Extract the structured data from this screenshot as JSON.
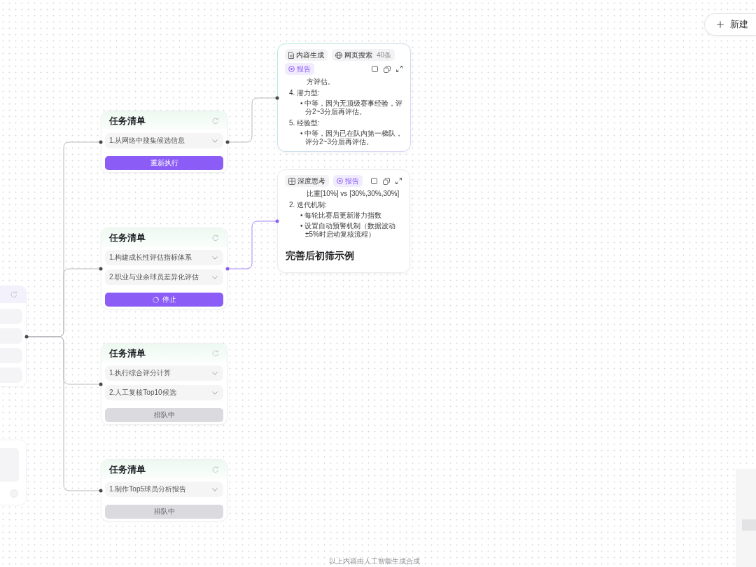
{
  "toolbar": {
    "new_button": {
      "label": "新建"
    }
  },
  "task_cards": [
    {
      "title": "任务清单",
      "tasks": [
        {
          "label": "1.从网络中搜集候选信息",
          "expanded": false
        }
      ],
      "action": {
        "kind": "rerun",
        "label": "重新执行"
      }
    },
    {
      "title": "任务清单",
      "tasks": [
        {
          "label": "1.构建成长性评估指标体系",
          "expanded": false
        },
        {
          "label": "2.职业与业余球员差异化评估",
          "expanded": false
        }
      ],
      "action": {
        "kind": "running",
        "label": "停止"
      }
    },
    {
      "title": "任务清单",
      "tasks": [
        {
          "label": "1.执行综合评分计算",
          "expanded": false
        },
        {
          "label": "2.人工复核Top10候选",
          "expanded": false
        }
      ],
      "action": {
        "kind": "queued",
        "label": "排队中"
      }
    },
    {
      "title": "任务清单",
      "tasks": [
        {
          "label": "1.制作Top5球员分析报告",
          "expanded": false
        }
      ],
      "action": {
        "kind": "queued",
        "label": "排队中"
      }
    }
  ],
  "output_cards": [
    {
      "selected": true,
      "link_active": false,
      "chips": [
        {
          "kind": "content",
          "label": "内容生成"
        },
        {
          "kind": "search",
          "label": "网页搜索",
          "count": "40条"
        },
        {
          "kind": "report",
          "label": "报告"
        }
      ],
      "blocks": [
        {
          "kind": "text",
          "text": "方评估。"
        },
        {
          "kind": "numbered",
          "text": "4. 潜力型:"
        },
        {
          "kind": "bullet",
          "text": "• 中等，因为无顶级赛事经验，评分2~3分后再评估。"
        },
        {
          "kind": "numbered",
          "text": "5. 经验型:"
        },
        {
          "kind": "bullet",
          "text": "• 中等，因为已在队内第一梯队，评分2~3分后再评估。"
        }
      ]
    },
    {
      "selected": false,
      "link_active": true,
      "chips": [
        {
          "kind": "thinking",
          "label": "深度思考"
        },
        {
          "kind": "report",
          "label": "报告"
        }
      ],
      "blocks": [
        {
          "kind": "text",
          "text": "比重[10%] vs [30%,30%,30%]"
        },
        {
          "kind": "numbered",
          "text": "2. 迭代机制:"
        },
        {
          "kind": "bullet",
          "text": "• 每轮比赛后更新潜力指数"
        },
        {
          "kind": "bullet",
          "text": "• 设置自动预警机制（数据波动±5%时启动复核流程）"
        },
        {
          "kind": "heading",
          "text": "完善后初筛示例"
        }
      ]
    }
  ],
  "footer": {
    "text": "以上内容由人工智能生成合成"
  }
}
